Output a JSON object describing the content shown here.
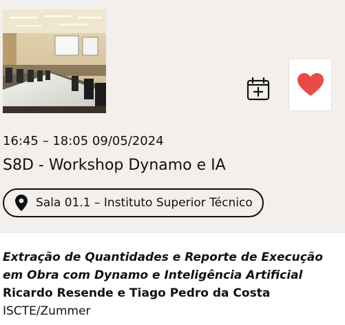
{
  "session": {
    "time": "16:45 – 18:05 09/05/2024",
    "title": "S8D - Workshop Dynamo e IA",
    "location": "Sala 01.1 – Instituto Superior Técnico",
    "image": "conference-room-photo"
  },
  "actions": {
    "calendar_icon": "calendar-add-icon",
    "favorite_icon": "heart-icon",
    "favorite_color": "#ea4a43"
  },
  "talk": {
    "title": "Extração de Quantidades e Reporte de Execução em Obra com Dynamo e Inteligência Artificial",
    "authors": "Ricardo Resende e Tiago Pedro da Costa",
    "affiliation": "ISCTE/Zummer"
  },
  "colors": {
    "header_background": "#f2efec",
    "text": "#111111"
  }
}
